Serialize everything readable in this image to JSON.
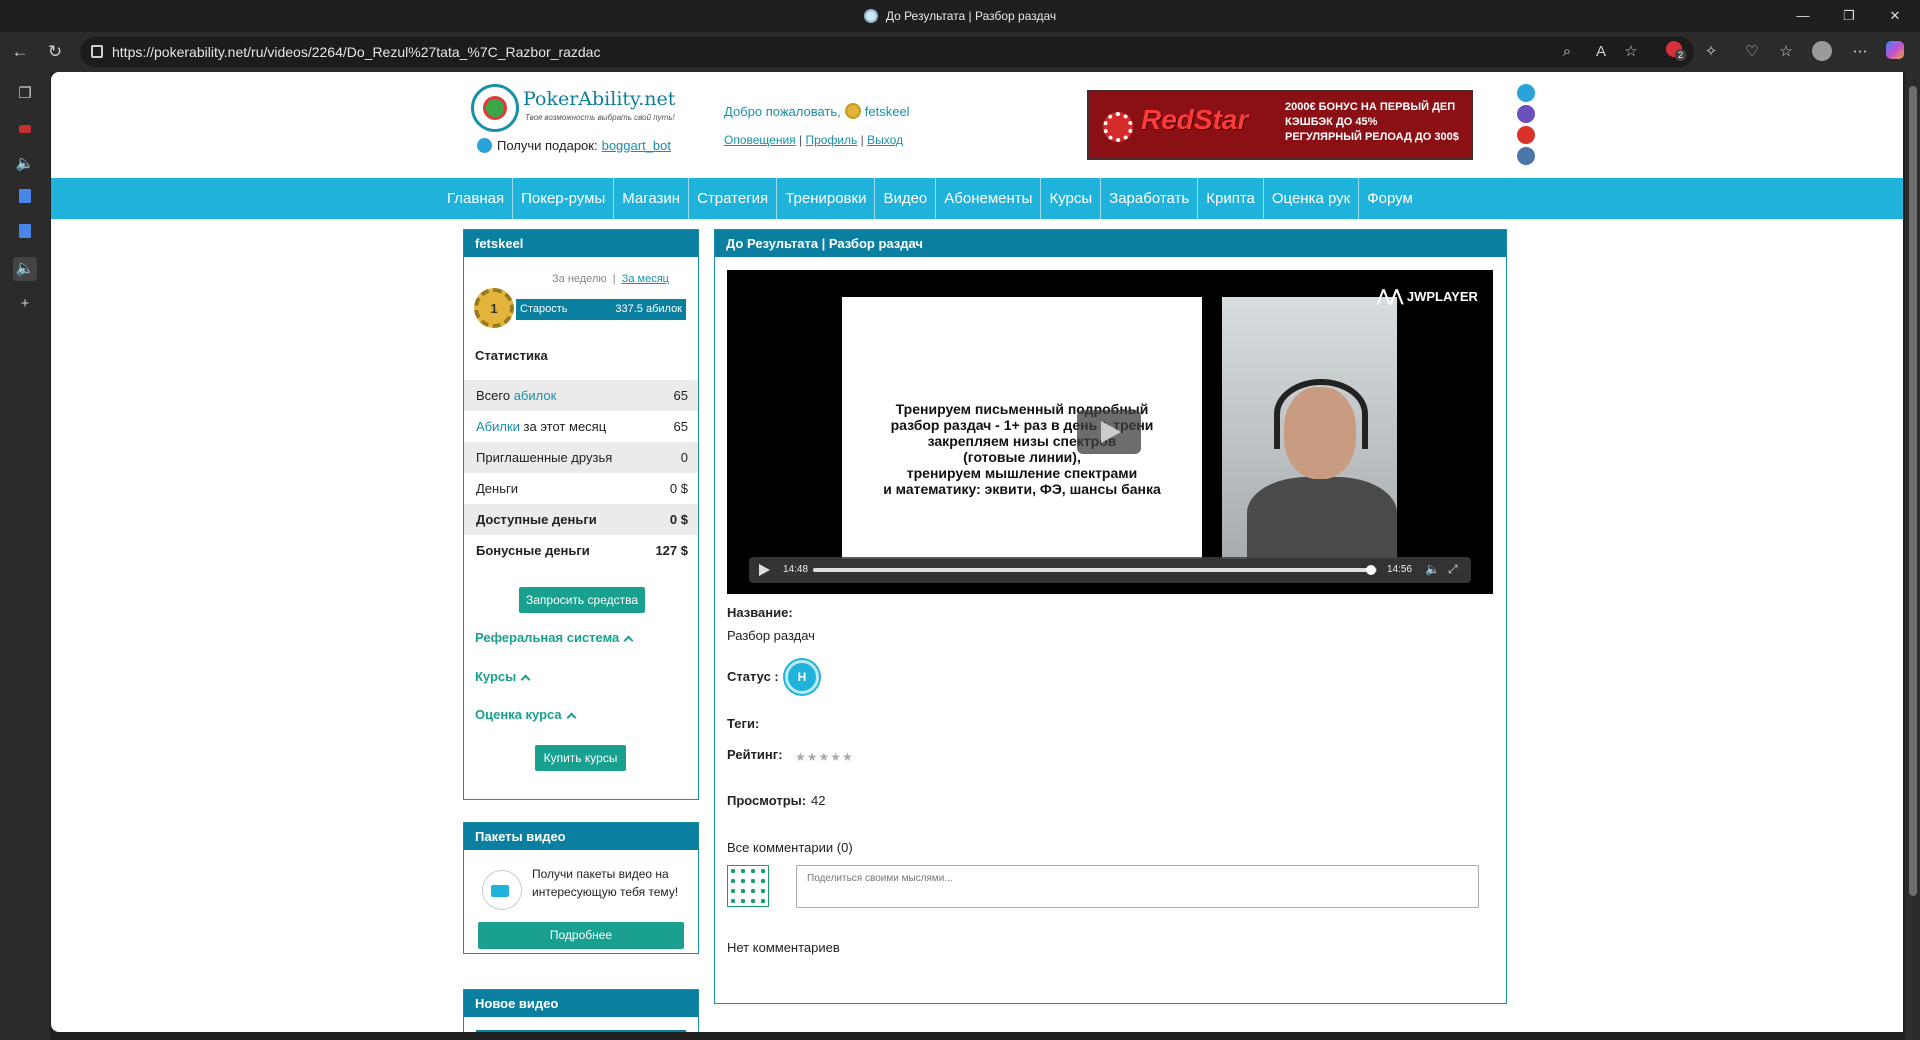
{
  "browser": {
    "tab_title": "До Результата | Разбор раздач",
    "url": "https://pokerability.net/ru/videos/2264/Do_Rezul%27tata_%7C_Razbor_razdac",
    "ext_badge": "2",
    "win_min": "—",
    "win_max": "❐",
    "win_close": "✕"
  },
  "header": {
    "logo_name": "PokerAbility.net",
    "logo_slogan": "Твоя возможность выбрать свой путь!",
    "gift_label": "Получи подарок:",
    "gift_link": "boggart_bot",
    "welcome_label": "Добро пожаловать,",
    "username": "fetskeel",
    "links": [
      "Оповещения",
      "Профиль",
      "Выход"
    ],
    "banner_brand": "RedStar",
    "banner_lines": [
      "2000€ БОНУС НА ПЕРВЫЙ ДЕП",
      "КЭШБЭК ДО 45%",
      "РЕГУЛЯРНЫЙ РЕЛОАД ДО 300$"
    ]
  },
  "menu": [
    "Главная",
    "Покер-румы",
    "Магазин",
    "Стратегия",
    "Тренировки",
    "Видео",
    "Абонементы",
    "Курсы",
    "Заработать",
    "Крипта",
    "Оценка рук",
    "Форум"
  ],
  "user_panel": {
    "title": "fetskeel",
    "period_week": "За неделю",
    "period_month": "За месяц",
    "rank_number": "1",
    "rank_name": "Старость",
    "rank_value": "337.5 абилок",
    "stats_title": "Статистика",
    "stats": [
      {
        "pre": "Всего ",
        "link": "абилок",
        "post": "",
        "value": "65"
      },
      {
        "pre": "",
        "link": "Абилки",
        "post": " за этот месяц",
        "value": "65"
      },
      {
        "pre": "Приглашенные друзья",
        "link": "",
        "post": "",
        "value": "0"
      },
      {
        "pre": "Деньги",
        "link": "",
        "post": "",
        "value": "0 $"
      },
      {
        "pre": "Доступные деньги",
        "link": "",
        "post": "",
        "value": "0 $"
      },
      {
        "pre": "Бонусные деньги",
        "link": "",
        "post": "",
        "value": "127 $"
      }
    ],
    "request_btn": "Запросить средства",
    "acc_referral": "Реферальная система",
    "acc_courses": "Курсы",
    "acc_rating": "Оценка курса",
    "buy_btn": "Купить курсы"
  },
  "packs_panel": {
    "title": "Пакеты видео",
    "text": "Получи пакеты видео на интересующую тебя тему!",
    "btn": "Подробнее"
  },
  "new_panel": {
    "title": "Новое видео"
  },
  "main": {
    "title": "До Результата | Разбор раздач",
    "video": {
      "slide_lines": [
        "Тренируем письменный подробный",
        "разбор раздач - 1+ раз в день + трени",
        "закрепляем низы спектров",
        "(готовые линии),",
        "тренируем мышление спектрами",
        "и математику: эквити, ФЭ, шансы банка"
      ],
      "player": "JWPLAYER",
      "elapsed": "14:48",
      "duration": "14:56",
      "progress": 0.99
    },
    "name_label": "Название:",
    "name_value": "Разбор раздач",
    "status_label": "Статус :",
    "status_value": "Н",
    "tags_label": "Теги:",
    "rating_label": "Рейтинг:",
    "rating_stars": "★★★★★",
    "views_label": "Просмотры:",
    "views_value": "42",
    "comments_label": "Все комментарии (0)",
    "comment_placeholder": "Поделиться своими мыслями...",
    "no_comments": "Нет комментариев"
  },
  "colors": {
    "accent": "#1fb3db",
    "panel_head": "#0b7fa0",
    "button": "#1aa08f"
  }
}
